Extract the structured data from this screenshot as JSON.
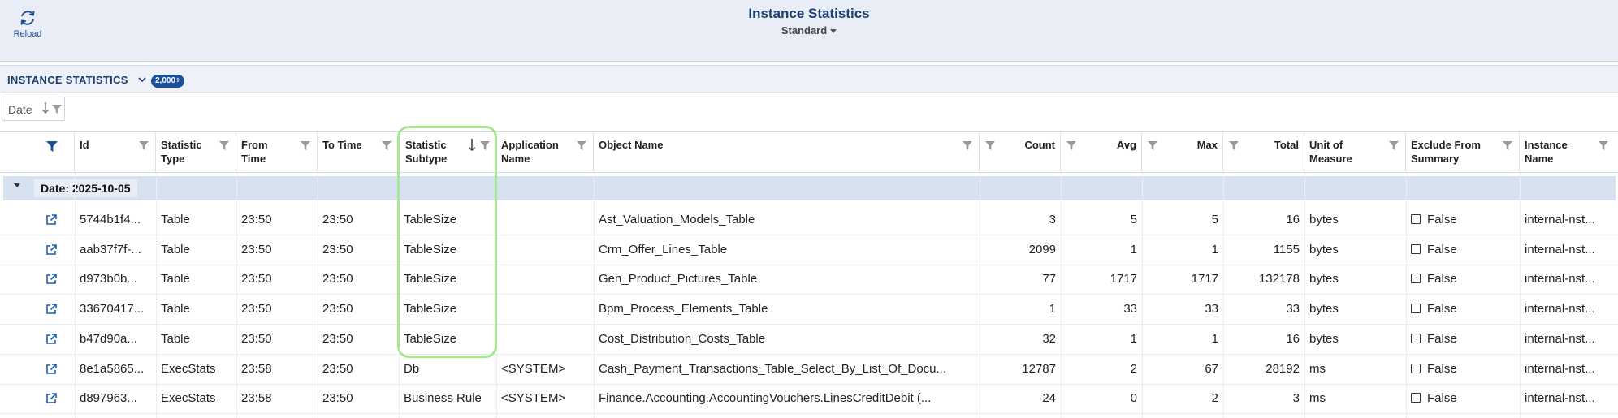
{
  "header": {
    "reload_label": "Reload",
    "title": "Instance Statistics",
    "view_name": "Standard"
  },
  "section": {
    "title": "INSTANCE STATISTICS",
    "count_badge": "2,000+"
  },
  "grouping": {
    "label": "Date"
  },
  "columns": {
    "id": "Id",
    "statistic_type": [
      "Statistic",
      "Type"
    ],
    "from_time": [
      "From",
      "Time"
    ],
    "to_time": "To Time",
    "statistic_subtype": [
      "Statistic",
      "Subtype"
    ],
    "application_name": [
      "Application",
      "Name"
    ],
    "object_name": "Object Name",
    "count": "Count",
    "avg": "Avg",
    "max": "Max",
    "total": "Total",
    "unit_of_measure": [
      "Unit of",
      "Measure"
    ],
    "exclude_from_summary": [
      "Exclude From",
      "Summary"
    ],
    "instance_name": [
      "Instance",
      "Name"
    ]
  },
  "group": {
    "label": "Date: 2025-10-05"
  },
  "rows": [
    {
      "id": "5744b1f4...",
      "type": "Table",
      "from": "23:50",
      "to": "23:50",
      "subtype": "TableSize",
      "app": "",
      "object": "Ast_Valuation_Models_Table",
      "count": "3",
      "avg": "5",
      "max": "5",
      "total": "16",
      "unit": "bytes",
      "exclude": "False",
      "instance": "internal-nst..."
    },
    {
      "id": "aab37f7f-...",
      "type": "Table",
      "from": "23:50",
      "to": "23:50",
      "subtype": "TableSize",
      "app": "",
      "object": "Crm_Offer_Lines_Table",
      "count": "2099",
      "avg": "1",
      "max": "1",
      "total": "1155",
      "unit": "bytes",
      "exclude": "False",
      "instance": "internal-nst..."
    },
    {
      "id": "d973b0b...",
      "type": "Table",
      "from": "23:50",
      "to": "23:50",
      "subtype": "TableSize",
      "app": "",
      "object": "Gen_Product_Pictures_Table",
      "count": "77",
      "avg": "1717",
      "max": "1717",
      "total": "132178",
      "unit": "bytes",
      "exclude": "False",
      "instance": "internal-nst..."
    },
    {
      "id": "33670417...",
      "type": "Table",
      "from": "23:50",
      "to": "23:50",
      "subtype": "TableSize",
      "app": "",
      "object": "Bpm_Process_Elements_Table",
      "count": "1",
      "avg": "33",
      "max": "33",
      "total": "33",
      "unit": "bytes",
      "exclude": "False",
      "instance": "internal-nst..."
    },
    {
      "id": "b47d90a...",
      "type": "Table",
      "from": "23:50",
      "to": "23:50",
      "subtype": "TableSize",
      "app": "",
      "object": "Cost_Distribution_Costs_Table",
      "count": "32",
      "avg": "1",
      "max": "1",
      "total": "16",
      "unit": "bytes",
      "exclude": "False",
      "instance": "internal-nst..."
    },
    {
      "id": "8e1a5865...",
      "type": "ExecStats",
      "from": "23:58",
      "to": "23:50",
      "subtype": "Db",
      "app": "<SYSTEM>",
      "object": "Cash_Payment_Transactions_Table_Select_By_List_Of_Docu...",
      "count": "12787",
      "avg": "2",
      "max": "67",
      "total": "28192",
      "unit": "ms",
      "exclude": "False",
      "instance": "internal-nst..."
    },
    {
      "id": "d897963...",
      "type": "ExecStats",
      "from": "23:58",
      "to": "23:50",
      "subtype": "Business Rule",
      "app": "<SYSTEM>",
      "object": "Finance.Accounting.AccountingVouchers.LinesCreditDebit (...",
      "count": "24",
      "avg": "0",
      "max": "2",
      "total": "3",
      "unit": "ms",
      "exclude": "False",
      "instance": "internal-nst..."
    }
  ]
}
